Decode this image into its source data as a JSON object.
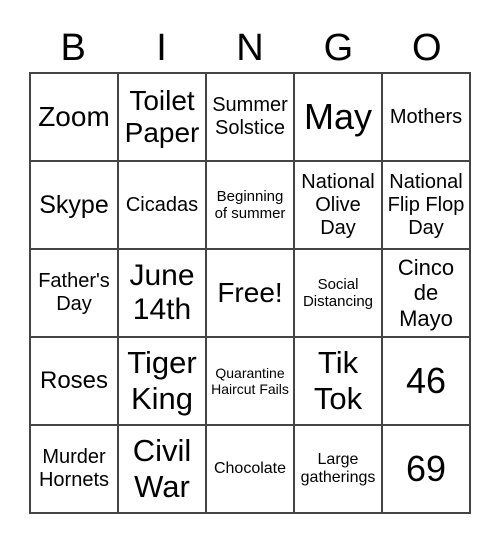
{
  "header": [
    "B",
    "I",
    "N",
    "G",
    "O"
  ],
  "cells": [
    "Zoom",
    "Toilet Paper",
    "Summer Solstice",
    "May",
    "Mothers",
    "Skype",
    "Cicadas",
    "Beginning of summer",
    "National Olive Day",
    "National Flip Flop Day",
    "Father's Day",
    "June 14th",
    "Free!",
    "Social Distancing",
    "Cinco de Mayo",
    "Roses",
    "Tiger King",
    "Quarantine Haircut Fails",
    "Tik Tok",
    "46",
    "Murder Hornets",
    "Civil War",
    "Chocolate",
    "Large gatherings",
    "69"
  ]
}
